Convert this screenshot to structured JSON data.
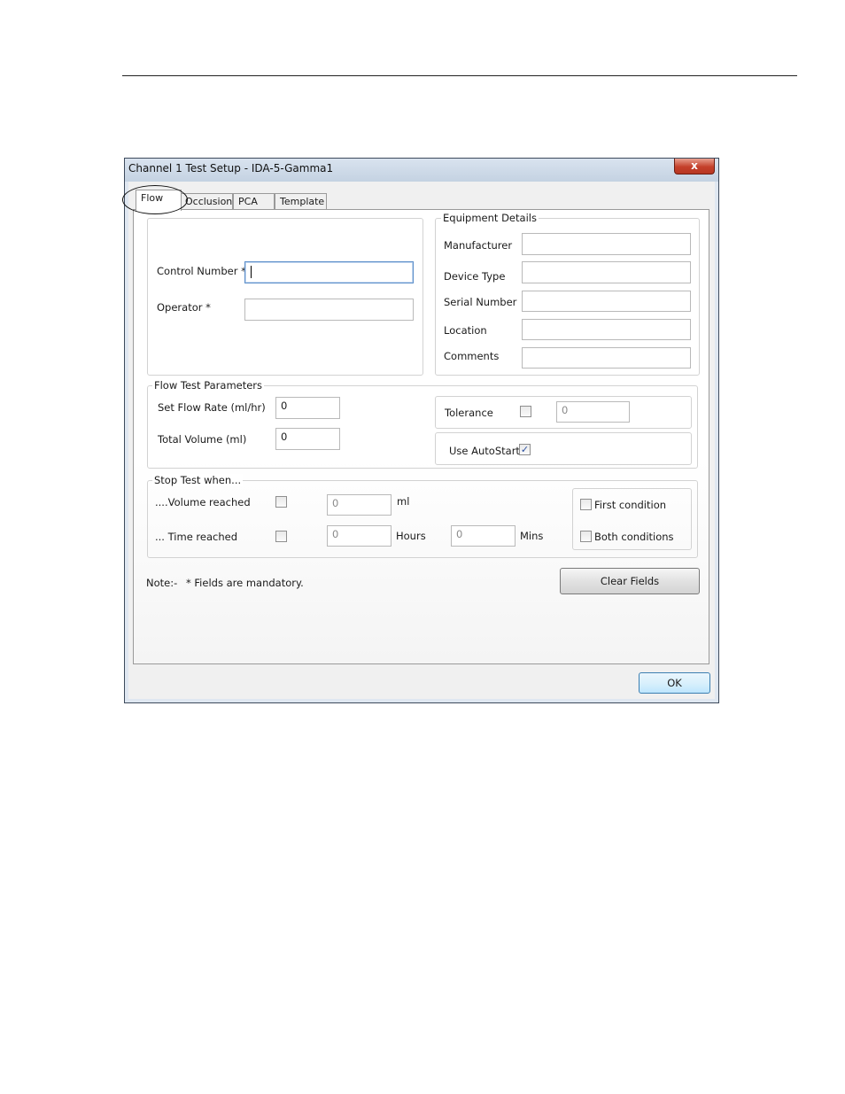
{
  "window": {
    "title": "Channel 1 Test Setup - IDA-5-Gamma1",
    "close_label": "x"
  },
  "tabs": [
    {
      "label": "Flow"
    },
    {
      "label": "Occlusion"
    },
    {
      "label": "PCA"
    },
    {
      "label": "Template"
    }
  ],
  "operator_group": {
    "control_number_label": "Control Number *",
    "control_number_value": "",
    "operator_label": "Operator *",
    "operator_value": ""
  },
  "equipment": {
    "title": "Equipment Details",
    "fields": [
      {
        "label": "Manufacturer",
        "value": ""
      },
      {
        "label": "Device Type",
        "value": ""
      },
      {
        "label": "Serial Number",
        "value": ""
      },
      {
        "label": "Location",
        "value": ""
      },
      {
        "label": "Comments",
        "value": ""
      }
    ]
  },
  "flow_params": {
    "title": "Flow Test Parameters",
    "set_flow_rate_label": "Set Flow Rate (ml/hr)",
    "set_flow_rate_value": "0",
    "total_volume_label": "Total Volume (ml)",
    "total_volume_value": "0",
    "tolerance_label": "Tolerance",
    "tolerance_checked": false,
    "tolerance_value": "0",
    "autostart_label": "Use AutoStart",
    "autostart_checked": true,
    "autostart_mark": "✓"
  },
  "stop_test": {
    "title": "Stop Test when...",
    "volume_label": "....Volume reached",
    "volume_checked": false,
    "volume_value": "0",
    "volume_unit": "ml",
    "time_label": "... Time reached",
    "time_checked": false,
    "hours_value": "0",
    "hours_unit": "Hours",
    "mins_value": "0",
    "mins_unit": "Mins",
    "first_condition_label": "First condition",
    "both_conditions_label": "Both conditions"
  },
  "note": {
    "prefix": "Note:-",
    "text": "* Fields are mandatory."
  },
  "buttons": {
    "clear_fields": "Clear Fields",
    "ok": "OK"
  }
}
